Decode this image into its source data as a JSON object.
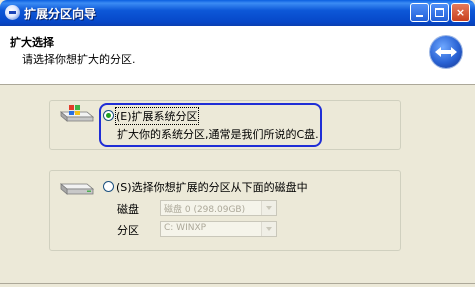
{
  "window": {
    "title": "扩展分区向导",
    "min_label": "",
    "max_label": "",
    "close_label": "×"
  },
  "header": {
    "title": "扩大选择",
    "subtitle": "请选择你想扩大的分区."
  },
  "option1": {
    "label": "(E)扩展系统分区",
    "description": "扩大你的系统分区,通常是我们所说的C盘.",
    "selected": true
  },
  "option2": {
    "label": "(S)选择你想扩展的分区从下面的磁盘中",
    "selected": false,
    "disk_label": "磁盘",
    "disk_value": "磁盘 0 (298.09GB)",
    "partition_label": "分区",
    "partition_value": "C: WINXP"
  },
  "colors": {
    "title_bar": "#0a5fe0",
    "focus_outline": "#1f2ed6",
    "radio_dot": "#21a121"
  }
}
